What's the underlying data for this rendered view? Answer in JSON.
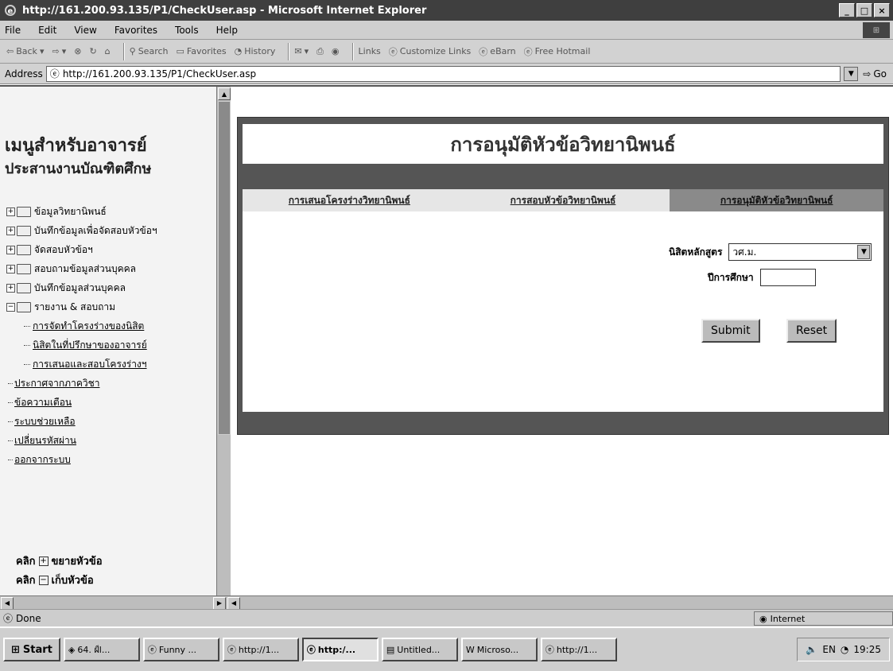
{
  "window": {
    "title": "http://161.200.93.135/P1/CheckUser.asp - Microsoft Internet Explorer",
    "buttons": [
      "_",
      "□",
      "×"
    ]
  },
  "menu": [
    "File",
    "Edit",
    "View",
    "Favorites",
    "Tools",
    "Help"
  ],
  "toolbar": {
    "back": "Back",
    "search": "Search",
    "favorites": "Favorites",
    "history": "History",
    "links": "Links",
    "customize_links": "Customize Links",
    "ebarn": "eBarn",
    "free_hotmail": "Free Hotmail"
  },
  "address": {
    "label": "Address",
    "url": "http://161.200.93.135/P1/CheckUser.asp",
    "go": "Go"
  },
  "left": {
    "title_line1": "เมนูสำหรับอาจารย์",
    "title_line2": "ประสานงานบัณฑิตศึกษ",
    "tree": [
      {
        "label": "ข้อมูลวิทยานิพนธ์",
        "toggle": "+"
      },
      {
        "label": "บันทึกข้อมูลเพื่อจัดสอบหัวข้อฯ",
        "toggle": "+"
      },
      {
        "label": "จัดสอบหัวข้อฯ",
        "toggle": "+"
      },
      {
        "label": "สอบถามข้อมูลส่วนบุคคล",
        "toggle": "+"
      },
      {
        "label": "บันทึกข้อมูลส่วนบุคคล",
        "toggle": "+"
      },
      {
        "label": "รายงาน & สอบถาม",
        "toggle": "−"
      }
    ],
    "subitems": [
      "การจัดทำโครงร่างของนิสิต",
      "นิสิตในที่ปรึกษาของอาจารย์",
      "การเสนอและสอบโครงร่างฯ"
    ],
    "links": [
      "ประกาศจากภาควิชา",
      "ข้อความเตือน",
      "ระบบช่วยเหลือ",
      "เปลี่ยนรหัสผ่าน",
      "ออกจากระบบ"
    ],
    "help_expand": {
      "word": "คลิก",
      "box": "+",
      "text": "ขยายหัวข้อ"
    },
    "help_collapse": {
      "word": "คลิก",
      "box": "−",
      "text": "เก็บหัวข้อ"
    }
  },
  "main": {
    "header": "การอนุมัติหัวข้อวิทยานิพนธ์",
    "tabs": [
      {
        "label": "การเสนอโครงร่างวิทยานิพนธ์",
        "active": false
      },
      {
        "label": "การสอบหัวข้อวิทยานิพนธ์",
        "active": false
      },
      {
        "label": "การอนุมัติหัวข้อวิทยานิพนธ์",
        "active": true
      }
    ],
    "program_label": "นิสิตหลักสูตร",
    "program_value": "วศ.ม.",
    "year_label": "ปีการศึกษา",
    "year_value": "",
    "submit": "Submit",
    "reset": "Reset"
  },
  "status": {
    "text": "Done",
    "zone": "Internet"
  },
  "taskbar": {
    "start": "Start",
    "tasks": [
      {
        "label": "64. ฝ์l...",
        "active": false
      },
      {
        "label": "Funny ...",
        "active": false
      },
      {
        "label": "http://1...",
        "active": false
      },
      {
        "label": "http:/...",
        "active": true
      },
      {
        "label": "Untitled...",
        "active": false
      },
      {
        "label": "Microso...",
        "active": false
      },
      {
        "label": "http://1...",
        "active": false
      }
    ],
    "tray_lang": "EN",
    "time": "19:25"
  }
}
